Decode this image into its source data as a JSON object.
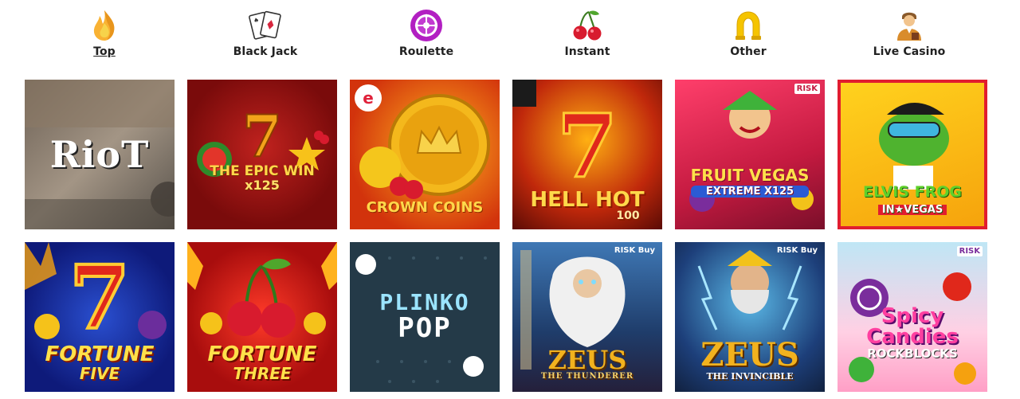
{
  "categories": [
    {
      "label": "Top",
      "icon": "flame-icon",
      "active": true
    },
    {
      "label": "Black Jack",
      "icon": "playing-cards-icon",
      "active": false
    },
    {
      "label": "Roulette",
      "icon": "roulette-icon",
      "active": false
    },
    {
      "label": "Instant",
      "icon": "cherries-icon",
      "active": false
    },
    {
      "label": "Other",
      "icon": "horseshoe-icon",
      "active": false
    },
    {
      "label": "Live Casino",
      "icon": "dealer-icon",
      "active": false
    }
  ],
  "games": [
    {
      "title": "RioT",
      "subtitle": ""
    },
    {
      "title": "The Epic Win",
      "subtitle": "x125"
    },
    {
      "title": "Crown Coins",
      "subtitle": ""
    },
    {
      "title": "Hell Hot",
      "subtitle": "100"
    },
    {
      "title": "Fruit Vegas",
      "subtitle": "Extreme x125",
      "badge": "RISK"
    },
    {
      "title": "Elvis Frog",
      "subtitle": "in★Vegas"
    },
    {
      "title": "Fortune",
      "subtitle": "Five"
    },
    {
      "title": "Fortune",
      "subtitle": "Three"
    },
    {
      "title": "Plinko",
      "subtitle": "Pop"
    },
    {
      "title": "Zeus",
      "subtitle": "The Thunderer",
      "badge": "RISK Buy"
    },
    {
      "title": "Zeus",
      "subtitle": "The Invincible",
      "badge": "RISK Buy"
    },
    {
      "title": "Spicy Candies",
      "subtitle": "Rockblocks",
      "badge": "RISK"
    }
  ]
}
